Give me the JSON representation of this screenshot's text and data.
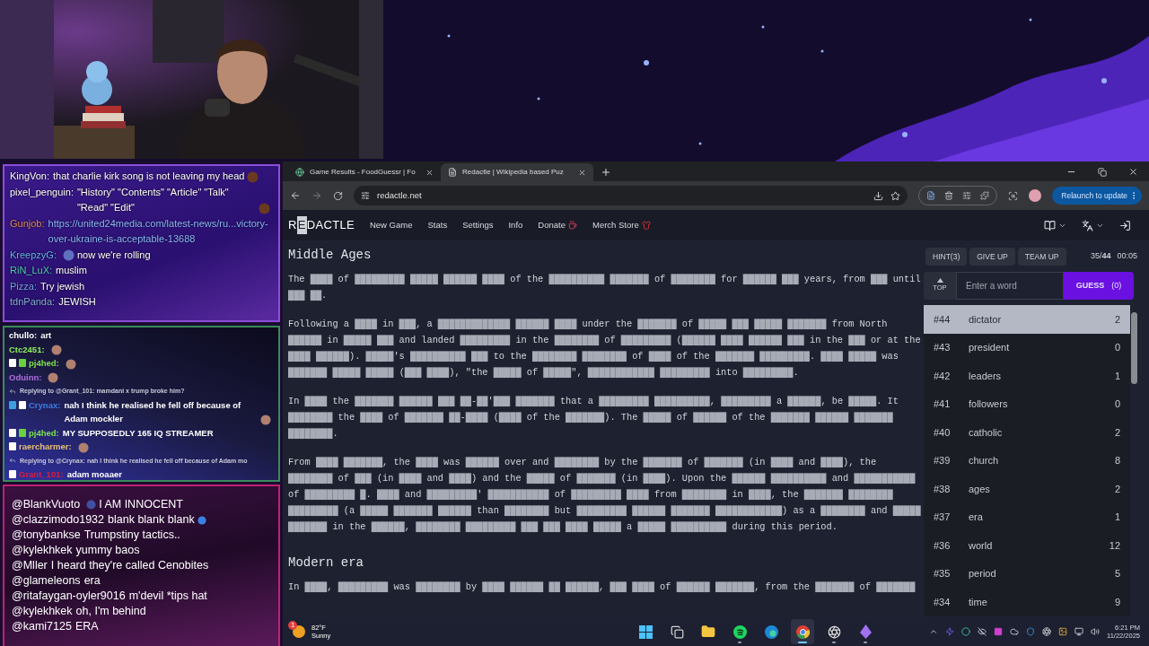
{
  "chat_top": [
    {
      "user": "KingVon:",
      "color": "#ffffff",
      "kind": "text",
      "text": "that charlie kirk song is not leaving my head",
      "emote_before": false,
      "emote_after": true
    },
    {
      "user": "pixel_penguin:",
      "color": "#ffffff",
      "kind": "text",
      "text": "\"History\" \"Contents\" \"Article\" \"Talk\" \"Read\" \"Edit\"",
      "emote_before": false,
      "emote_after": true
    },
    {
      "user": "Gunjob:",
      "color": "#e08a5a",
      "kind": "link",
      "text": "https://united24media.com/latest-news/ru...victory-over-ukraine-is-acceptable-13688",
      "emote_before": false,
      "emote_after": false
    },
    {
      "user": "KreepzyG:",
      "color": "#62b4ea",
      "kind": "text",
      "text": "now we're rolling",
      "emote_before": true,
      "emote_after": false
    },
    {
      "user": "RiN_LuX:",
      "color": "#4ccfb4",
      "kind": "text",
      "text": "muslim",
      "emote_before": false,
      "emote_after": false
    },
    {
      "user": "Pizza:",
      "color": "#6fa2e4",
      "kind": "text",
      "text": "Try jewish",
      "emote_before": false,
      "emote_after": false
    },
    {
      "user": "tdnPanda:",
      "color": "#84acd8",
      "kind": "text",
      "text": "JEWISH",
      "emote_before": false,
      "emote_after": false
    }
  ],
  "chat_middle": [
    {
      "kind": "message",
      "user": "chullo:",
      "color": "#ffffff",
      "text": "art",
      "emote": false
    },
    {
      "kind": "message",
      "user": "Ctc2451:",
      "color": "#8ef05a",
      "emote": true
    },
    {
      "kind": "message",
      "user": "pj4hed:",
      "color": "#7ee04a",
      "badges": [
        {
          "color": "#ffffff"
        },
        {
          "color": "#6ad040"
        }
      ],
      "emote": true
    },
    {
      "kind": "message",
      "user": "Oduinn:",
      "color": "#b070e0",
      "emote": true
    },
    {
      "kind": "reply",
      "text": "Replying to @Grant_101: mamdani x trump broke him?"
    },
    {
      "kind": "message",
      "user": "Crynax:",
      "color": "#3d7fe0",
      "badges": [
        {
          "color": "#3aa0e0"
        },
        {
          "color": "#ffffff"
        }
      ],
      "text": "nah I think he realised he fell off because of Adam mockler",
      "emote": true
    },
    {
      "kind": "message",
      "user": "pj4hed:",
      "color": "#7ee04a",
      "badges": [
        {
          "color": "#ffffff"
        },
        {
          "color": "#6ad040"
        }
      ],
      "text": "MY SUPPOSEDLY 165 IQ STREAMER",
      "emote": false
    },
    {
      "kind": "message",
      "user": "raercharmer:",
      "color": "#e8c070",
      "badges": [
        {
          "color": "#ffffff"
        }
      ],
      "emote": true
    },
    {
      "kind": "reply",
      "text": "Replying to @Crynax: nah I think he realised he fell off because of Adam mo"
    },
    {
      "kind": "message",
      "user": "Grant_101:",
      "color": "#d02040",
      "badges": [
        {
          "color": "#ffffff"
        }
      ],
      "text": "adam moaaer",
      "emote": false
    }
  ],
  "chat_bottom": [
    {
      "user": "@BlankVuoto",
      "text": "I AM INNOCENT",
      "emote_before": true,
      "emote_after": false
    },
    {
      "user": "@clazzimodo1932",
      "text": "blank blank blank",
      "emote_before": false,
      "emote_after": true
    },
    {
      "user": "@tonybankse",
      "text": "Trumpstiny tactics..",
      "emote_before": false,
      "emote_after": false
    },
    {
      "user": "@kylekhkek",
      "text": "yummy baos",
      "emote_before": false,
      "emote_after": false
    },
    {
      "user": "@Mller",
      "text": "I heard they're called Cenobites",
      "emote_before": false,
      "emote_after": false
    },
    {
      "user": "@glameleons",
      "text": "era",
      "emote_before": false,
      "emote_after": false
    },
    {
      "user": "@ritafaygan-oyler9016",
      "text": "m'devil *tips hat",
      "emote_before": false,
      "emote_after": false
    },
    {
      "user": "@kylekhkek",
      "text": "oh, I'm behind",
      "emote_before": false,
      "emote_after": false
    },
    {
      "user": "@kami7125",
      "text": "ERA",
      "emote_before": false,
      "emote_after": false
    }
  ],
  "browser": {
    "tabs": [
      {
        "title": "Game Results - FoodGuessr | Fo",
        "selected": false
      },
      {
        "title": "Redactle | Wikipedia based Puz",
        "selected": true
      }
    ],
    "address": "redactle.net",
    "update_button": "Relaunch to update"
  },
  "site": {
    "logo": [
      {
        "text": "R",
        "boxed": false
      },
      {
        "text": "E",
        "boxed": true
      },
      {
        "text": "DACTLE",
        "boxed": false
      }
    ],
    "nav": [
      "New Game",
      "Stats",
      "Settings",
      "Info"
    ],
    "donate": "Donate",
    "merch": "Merch Store",
    "sections": [
      {
        "heading": "Middle Ages",
        "paragraphs": [
          "The ████ of █████████ █████ ██████ ████ of the ██████████ ███████ of ████████ for ██████ ███ years, from ███ until ███ ██.",
          "Following a ████ in ███, a █████████████ ██████ ████ under the ███████ of █████ ███ █████ ███████ from North ██████ in █████ ███ and landed █████████ in the ████████ of █████████ (██████ ████ ██████ ███ in the ███ or at the ████ ██████). █████'s ██████████ ███ to the ████████ ████████ of ████ of the ███████ █████████. ████ █████ was ███████ █████ █████ (███ ████), \"the █████ of █████\", ████████████ █████████ into █████████.",
          "In ████ the ███████ ██████ ███ ██-██'███ ███████ that a █████████ ██████████, █████████ a ██████, be █████. It ████████ the ████ of ███████ ██-████ (████ of the ███████). The █████ of ██████ of the ███████ ██████ ███████ ████████.",
          "From ████ ███████, the ████ was ██████ over and ████████ by the ███████ of ███████ (in ████ and ████), the ████████ of ███ (in ████ and ████) and the █████ of ███████ (in ████). Upon the ██████ ██████████ and ███████████ of █████████ █. ████ and █████████' ███████████ of █████████ ████ from ████████ in ████, the ███████ ████████ █████████ (a █████ ███████ ██████ than ████████ but █████████ ██████ ███████ ████████████) as a ████████ and █████ ███████ in the ██████, ████████ █████████ ███ ███ ████ █████ a █████ ██████████ during this period."
        ]
      },
      {
        "heading": "Modern era",
        "paragraphs": [
          "In ████, █████████ was ████████ by ████ ██████ ██ ██████, ███ ████ of ██████ ███████, from the ███████ of ███████"
        ]
      }
    ],
    "panel": {
      "hint": "HINT(3)",
      "give_up": "GIVE UP",
      "team_up": "TEAM UP",
      "progress": "35/**44**",
      "timer": "00:05",
      "top": "TOP",
      "guess_placeholder": "Enter a word",
      "guess_button": "GUESS",
      "guess_count": "(0)",
      "guesses": [
        {
          "number": "#44",
          "word": "dictator",
          "hits": "2",
          "selected": true
        },
        {
          "number": "#43",
          "word": "president",
          "hits": "0",
          "selected": false
        },
        {
          "number": "#42",
          "word": "leaders",
          "hits": "1",
          "selected": false
        },
        {
          "number": "#41",
          "word": "followers",
          "hits": "0",
          "selected": false
        },
        {
          "number": "#40",
          "word": "catholic",
          "hits": "2",
          "selected": false
        },
        {
          "number": "#39",
          "word": "church",
          "hits": "8",
          "selected": false
        },
        {
          "number": "#38",
          "word": "ages",
          "hits": "2",
          "selected": false
        },
        {
          "number": "#37",
          "word": "era",
          "hits": "1",
          "selected": false
        },
        {
          "number": "#36",
          "word": "world",
          "hits": "12",
          "selected": false
        },
        {
          "number": "#35",
          "word": "period",
          "hits": "5",
          "selected": false
        },
        {
          "number": "#34",
          "word": "time",
          "hits": "9",
          "selected": false
        }
      ]
    }
  },
  "taskbar": {
    "weather_badge": "1",
    "temperature": "82°F",
    "condition": "Sunny",
    "apps": [
      {
        "kind": "start",
        "running": false,
        "selected": false
      },
      {
        "kind": "taskview",
        "running": false,
        "selected": false
      },
      {
        "kind": "files",
        "running": false,
        "selected": false
      },
      {
        "kind": "music",
        "running": true,
        "selected": false
      },
      {
        "kind": "edge",
        "running": false,
        "selected": false
      },
      {
        "kind": "chrome",
        "running": true,
        "selected": true
      },
      {
        "kind": "obs",
        "running": true,
        "selected": false
      },
      {
        "kind": "crystal",
        "running": true,
        "selected": false
      }
    ],
    "time": "6:21 PM",
    "date": "11/22/2025"
  }
}
